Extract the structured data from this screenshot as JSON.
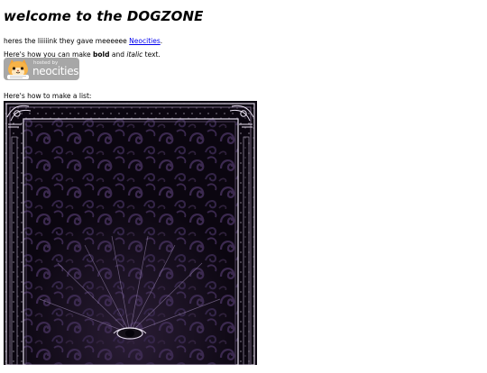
{
  "page": {
    "title": "welcome to the DOGZONE",
    "line1_prefix": "heres the liiiiink they gave meeeeee ",
    "line1_link": "Neocities",
    "line1_suffix": ".",
    "line2_a": "Here's how you can make ",
    "line2_bold": "bold",
    "line2_b": " and ",
    "line2_italic": "italic",
    "line2_c": " text.",
    "line3": "Here's how to make a list:"
  },
  "badge": {
    "hosted_text": "hosted by",
    "brand_text": "neocities",
    "icon": "cat-icon"
  },
  "image": {
    "icon": "tarot-card-image"
  },
  "colors": {
    "link": "#0000ee",
    "badge_bg": "#a7a7a7",
    "card_bg": "#0b0610",
    "card_swirl": "#3d2b52"
  }
}
